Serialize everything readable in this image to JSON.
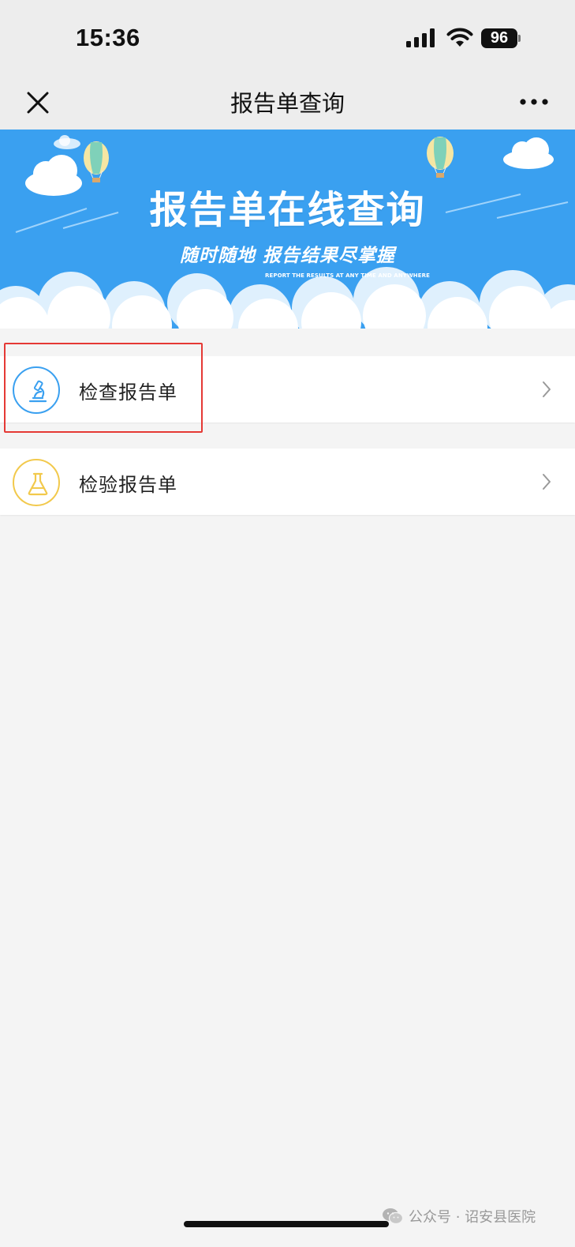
{
  "status_bar": {
    "time": "15:36",
    "battery_level": "96",
    "icons": [
      "signal-icon",
      "wifi-icon",
      "battery-icon"
    ]
  },
  "nav": {
    "title": "报告单查询",
    "close_icon": "close-icon",
    "more_icon": "more-icon"
  },
  "banner": {
    "title": "报告单在线查询",
    "subtitle": "随时随地  报告结果尽掌握",
    "english": "REPORT THE RESULTS AT ANY TIME AND ANYWHERE"
  },
  "menu": {
    "items": [
      {
        "label": "检查报告单",
        "icon": "microscope-icon",
        "accent": "#3aa0f0",
        "highlighted": true
      },
      {
        "label": "检验报告单",
        "icon": "flask-icon",
        "accent": "#f2c94c",
        "highlighted": false
      }
    ]
  },
  "footer": {
    "watermark": "公众号 · 诏安县医院"
  },
  "colors": {
    "banner_bg": "#3aa0f0",
    "highlight": "#e53935"
  }
}
